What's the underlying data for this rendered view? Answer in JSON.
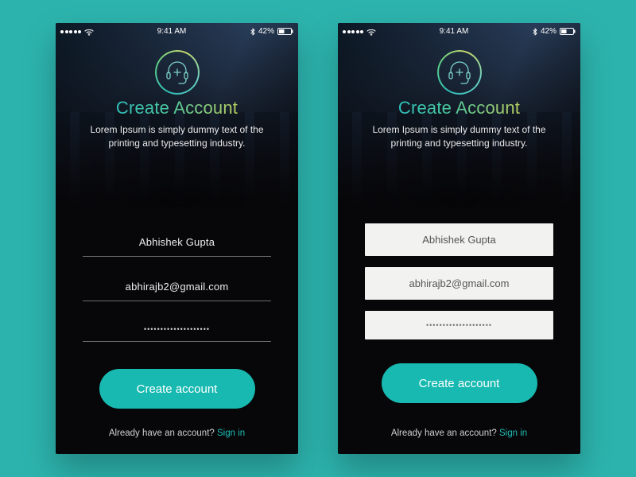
{
  "status": {
    "time": "9:41 AM",
    "battery_pct": "42%"
  },
  "header": {
    "title": "Create Account",
    "subtitle": "Lorem Ipsum is simply dummy text of the printing and typesetting industry."
  },
  "form": {
    "name_value": "Abhishek Gupta",
    "email_value": "abhirajb2@gmail.com",
    "password_value": "••••••••••••••••••••",
    "cta_label": "Create account"
  },
  "footer": {
    "prompt": "Already have an account? ",
    "link_label": "Sign in"
  },
  "colors": {
    "background": "#2db3ad",
    "accent": "#17b9b0"
  }
}
